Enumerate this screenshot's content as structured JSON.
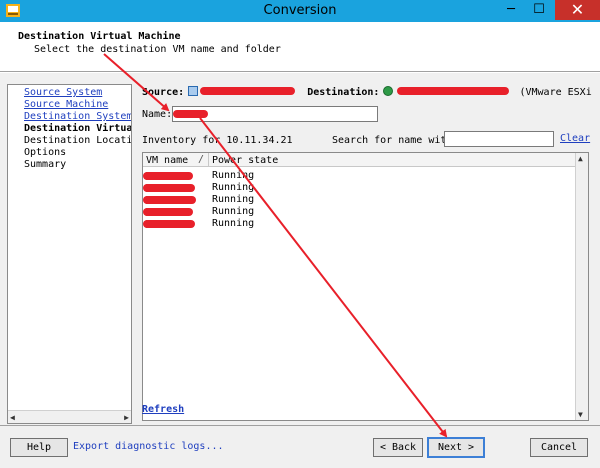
{
  "window": {
    "title": "Conversion",
    "minimize_glyph": "─",
    "maximize_glyph": "☐",
    "close_glyph": "✕"
  },
  "header": {
    "title": "Destination Virtual Machine",
    "subtitle": "Select the destination VM name and folder"
  },
  "nav": {
    "items": [
      {
        "label": "Source System"
      },
      {
        "label": "Source Machine"
      },
      {
        "label": "Destination System"
      },
      {
        "label": "Destination Virtua"
      },
      {
        "label": "Destination Location"
      },
      {
        "label": "Options"
      },
      {
        "label": "Summary"
      }
    ]
  },
  "panel": {
    "source_label": "Source:",
    "destination_label": "Destination:",
    "destination_suffix": "(VMware ESXi",
    "name_label": "Name:",
    "inventory_label": "Inventory for",
    "inventory_host": "10.11.34.21",
    "search_label": "Search for name with:",
    "clear_label": "Clear",
    "refresh_label": "Refresh"
  },
  "grid": {
    "columns": [
      "VM name",
      "Power state"
    ],
    "sort_glyph": "/",
    "rows": [
      {
        "state": "Running"
      },
      {
        "state": "Running"
      },
      {
        "state": "Running"
      },
      {
        "state": "Running"
      },
      {
        "state": "Running"
      }
    ]
  },
  "footer": {
    "help": "Help",
    "diagnostic": "Export diagnostic logs...",
    "back": "< Back",
    "next": "Next >",
    "cancel": "Cancel"
  },
  "colors": {
    "titlebar": "#1aa3de",
    "link": "#1f3fbf",
    "annotation": "#e8202a"
  }
}
